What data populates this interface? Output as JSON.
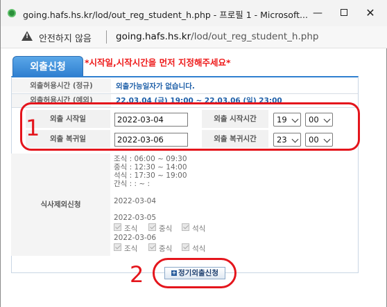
{
  "window": {
    "title": "going.hafs.hs.kr/lod/out_reg_student_h.php - 프로필 1 - Microsoft...",
    "controls": {
      "minimize": "—",
      "close": "✕"
    }
  },
  "address_bar": {
    "security_label": "안전하지 않음",
    "url_host": "going.hafs.hs.kr",
    "url_path": "/lod/out_reg_student_h.php"
  },
  "page": {
    "tab_label": "외출신청",
    "notice": "*시작일,시작시간을 먼저 지정해주세요*",
    "rows": [
      {
        "label": "외출허용시간 (정규)",
        "value": "외출가능일자가 없습니다."
      },
      {
        "label": "외출허용시간 (예외)",
        "value": "22.03.04 (금) 19:00 ~ 22.03.06 (일) 23:00"
      }
    ],
    "start_date_label": "외출 시작일",
    "start_date_value": "2022-03-04",
    "start_time_label": "외출 시작시간",
    "start_hour": "19",
    "start_minute": "00",
    "return_date_label": "외출 복귀일",
    "return_date_value": "2022-03-06",
    "return_time_label": "외출 복귀시간",
    "return_hour": "23",
    "return_minute": "00",
    "meal_section_label": "식사제외신청",
    "meal_times": [
      "조식 : 06:00 ~ 09:30",
      "중식 : 12:30 ~ 14:00",
      "석식 : 17:30 ~ 19:00",
      "간식 : : ~ :"
    ],
    "meal_dates": [
      "2022-03-04",
      "2022-03-05",
      "2022-03-06"
    ],
    "meal_options": [
      "조식",
      "중식",
      "석식"
    ],
    "apply_button": "정기외출신청"
  },
  "annotations": {
    "marker_1": "1",
    "marker_2": "2"
  },
  "colors": {
    "accent_blue": "#2f7fd0",
    "notice_red": "#ee1b1b",
    "annotation_red": "#e4151c",
    "value_blue": "#1e5fa8"
  }
}
